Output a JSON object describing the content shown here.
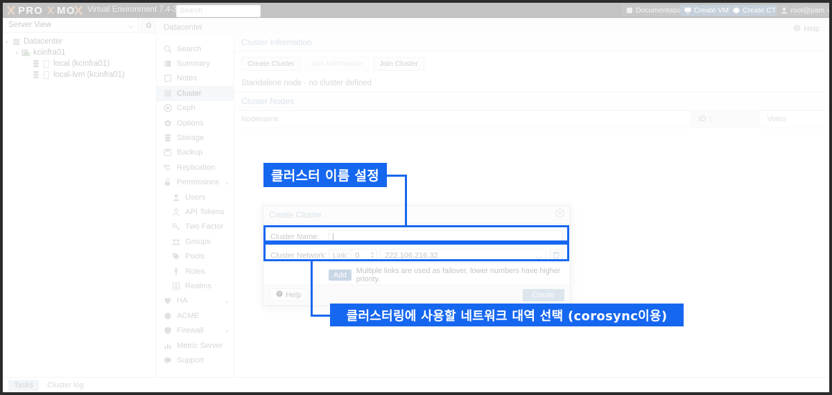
{
  "window": {
    "title": "Proxmox Virtual Environment 7.4-3"
  },
  "header": {
    "brand": "PROXMOX",
    "product": "Virtual Environment 7.4-3",
    "search_placeholder": "Search",
    "buttons": [
      {
        "label": "Documentation",
        "icon": "book-icon"
      },
      {
        "label": "Create VM",
        "icon": "display-icon"
      },
      {
        "label": "Create CT",
        "icon": "cube-icon"
      },
      {
        "label": "root@pam",
        "icon": "user-icon"
      }
    ]
  },
  "secondbar": {
    "view_selector": "Server View",
    "gear_icon": "gear-icon",
    "breadcrumb": "Datacenter",
    "help_label": "Help",
    "help_icon": "question-circle-icon"
  },
  "tree": {
    "items": [
      {
        "label": "Datacenter",
        "icon": "datacenter-icon",
        "depth": 0
      },
      {
        "label": "kcinfra01",
        "icon": "node-icon",
        "depth": 1
      },
      {
        "label": "local (kcinfra01)",
        "icon": "storage-icon",
        "depth": 2
      },
      {
        "label": "local-lvm (kcinfra01)",
        "icon": "storage-icon",
        "depth": 2
      }
    ]
  },
  "nav": {
    "items": [
      {
        "label": "Search",
        "icon": "search-icon",
        "selected": false,
        "sub": false
      },
      {
        "label": "Summary",
        "icon": "book-icon",
        "selected": false,
        "sub": false
      },
      {
        "label": "Notes",
        "icon": "note-icon",
        "selected": false,
        "sub": false
      },
      {
        "label": "Cluster",
        "icon": "cluster-icon",
        "selected": true,
        "sub": false
      },
      {
        "label": "Ceph",
        "icon": "ceph-icon",
        "selected": false,
        "sub": false
      },
      {
        "label": "Options",
        "icon": "gear-icon",
        "selected": false,
        "sub": false
      },
      {
        "label": "Storage",
        "icon": "storage-icon",
        "selected": false,
        "sub": false
      },
      {
        "label": "Backup",
        "icon": "backup-icon",
        "selected": false,
        "sub": false
      },
      {
        "label": "Replication",
        "icon": "replication-icon",
        "selected": false,
        "sub": false
      },
      {
        "label": "Permissions",
        "icon": "unlock-icon",
        "selected": false,
        "sub": false,
        "expandable": true
      },
      {
        "label": "Users",
        "icon": "user-icon",
        "selected": false,
        "sub": true
      },
      {
        "label": "API Tokens",
        "icon": "key-user-icon",
        "selected": false,
        "sub": true
      },
      {
        "label": "Two Factor",
        "icon": "key-icon",
        "selected": false,
        "sub": true
      },
      {
        "label": "Groups",
        "icon": "group-icon",
        "selected": false,
        "sub": true
      },
      {
        "label": "Pools",
        "icon": "tag-icon",
        "selected": false,
        "sub": true
      },
      {
        "label": "Roles",
        "icon": "role-icon",
        "selected": false,
        "sub": true
      },
      {
        "label": "Realms",
        "icon": "realm-icon",
        "selected": false,
        "sub": true
      },
      {
        "label": "HA",
        "icon": "heartbeat-icon",
        "selected": false,
        "sub": false,
        "expandable": true
      },
      {
        "label": "ACME",
        "icon": "certificate-icon",
        "selected": false,
        "sub": false
      },
      {
        "label": "Firewall",
        "icon": "shield-icon",
        "selected": false,
        "sub": false,
        "expandable": true
      },
      {
        "label": "Metric Server",
        "icon": "chart-bar-icon",
        "selected": false,
        "sub": false
      },
      {
        "label": "Support",
        "icon": "comment-icon",
        "selected": false,
        "sub": false
      }
    ]
  },
  "cluster_information": {
    "title": "Cluster Information",
    "buttons": [
      {
        "label": "Create Cluster",
        "disabled": false
      },
      {
        "label": "Join Information",
        "disabled": true
      },
      {
        "label": "Join Cluster",
        "disabled": false
      }
    ],
    "status": "Standalone node - no cluster defined"
  },
  "cluster_nodes": {
    "title": "Cluster Nodes",
    "columns": [
      "Nodename",
      "ID ↑",
      "Votes"
    ],
    "rows": []
  },
  "dialog": {
    "title": "Create Cluster",
    "close_icon": "close-circle-icon",
    "cluster_name": {
      "label": "Cluster Name:",
      "value": "",
      "placeholder": ""
    },
    "cluster_network": {
      "label": "Cluster Network:",
      "link_label": "Link:",
      "link_value": "0",
      "address": "222.106.216.32",
      "delete_icon": "trash-icon"
    },
    "add_button": "Add",
    "hint": "Multiple links are used as failover, lower numbers have higher priority.",
    "help_button": "Help",
    "help_icon": "question-circle-icon",
    "create_button": "Create"
  },
  "bottombar": {
    "tabs": [
      {
        "label": "Tasks",
        "active": true
      },
      {
        "label": "Cluster log",
        "active": false
      }
    ]
  },
  "annotations": {
    "accent_color": "#1667f0",
    "labels": [
      {
        "id": "name-note",
        "text": "클러스터 이름 설정"
      },
      {
        "id": "network-note",
        "text": "클러스터링에 사용할 네트워크 대역 선택 (corosync이용)"
      }
    ]
  }
}
